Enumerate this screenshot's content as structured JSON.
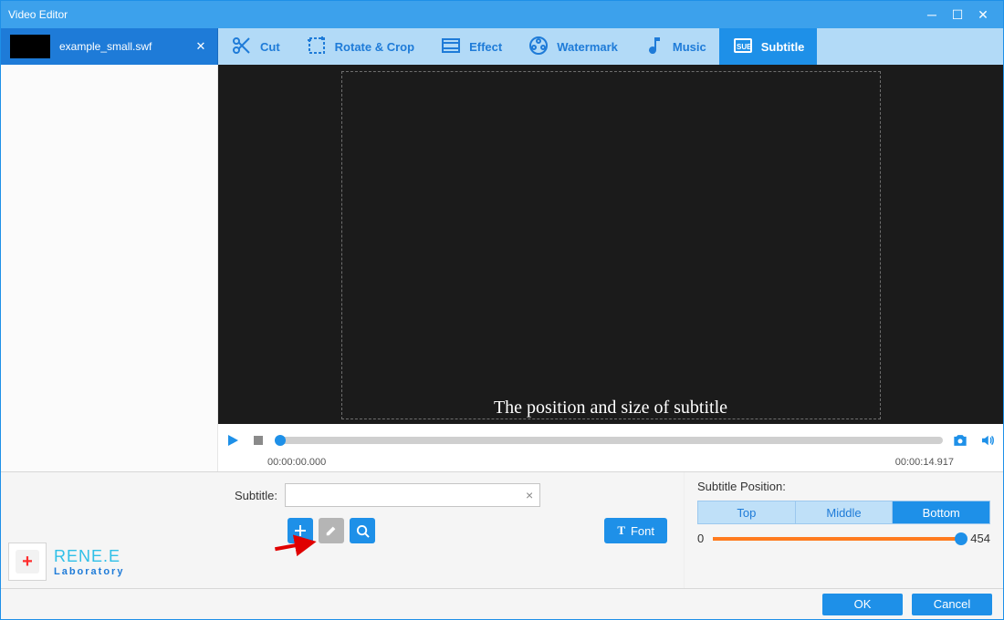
{
  "window": {
    "title": "Video Editor"
  },
  "file": {
    "name": "example_small.swf"
  },
  "tools": [
    {
      "key": "cut",
      "label": "Cut"
    },
    {
      "key": "rotate",
      "label": "Rotate & Crop"
    },
    {
      "key": "effect",
      "label": "Effect"
    },
    {
      "key": "watermark",
      "label": "Watermark"
    },
    {
      "key": "music",
      "label": "Music"
    },
    {
      "key": "subtitle",
      "label": "Subtitle"
    }
  ],
  "activeTool": "subtitle",
  "preview": {
    "subtitle_sample": "The position and size of subtitle"
  },
  "player": {
    "start": "00:00:00.000",
    "end": "00:00:14.917"
  },
  "subtitle": {
    "field_label": "Subtitle:",
    "value": "",
    "font_button": "Font"
  },
  "position": {
    "header": "Subtitle Position:",
    "options": {
      "top": "Top",
      "middle": "Middle",
      "bottom": "Bottom"
    },
    "selected": "bottom",
    "slider": {
      "min": 0,
      "max": 454,
      "value": 454
    }
  },
  "brand": {
    "name": "RENE.E",
    "sub": "Laboratory"
  },
  "footer": {
    "ok": "OK",
    "cancel": "Cancel"
  }
}
